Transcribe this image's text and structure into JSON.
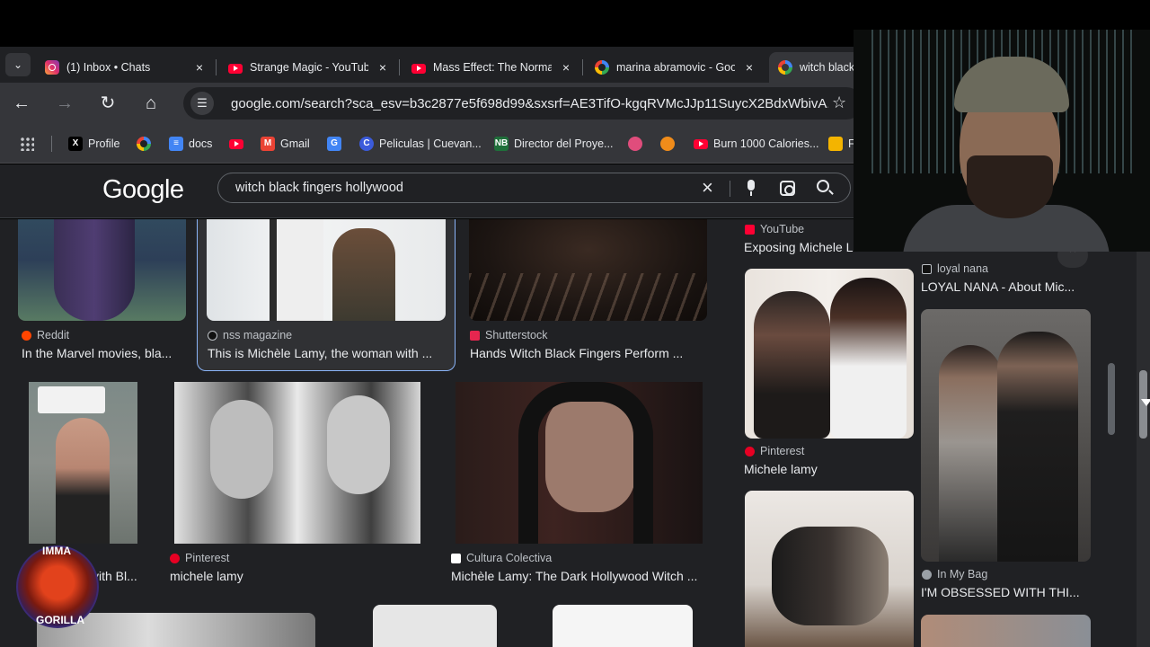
{
  "browser": {
    "tabs": [
      {
        "title": "(1) Inbox • Chats",
        "favicon": "instagram-icon",
        "active": false
      },
      {
        "title": "Strange Magic - YouTube",
        "favicon": "youtube-icon",
        "active": false
      },
      {
        "title": "Mass Effect: The Normandy",
        "favicon": "youtube-icon",
        "active": false
      },
      {
        "title": "marina abramovic - Google",
        "favicon": "google-icon",
        "active": false
      },
      {
        "title": "witch black",
        "favicon": "google-icon",
        "active": true
      }
    ],
    "close_glyph": "×",
    "url": "google.com/search?sca_esv=b3c2877e5f698d99&sxsrf=AE3TifO-kgqRVMcJJp11SuycX2BdxWbivA...",
    "bookmarks": [
      {
        "label": "Profile",
        "icon": "x-icon",
        "color": "#000000"
      },
      {
        "label": "",
        "icon": "google-icon",
        "color": "#ffffff"
      },
      {
        "label": "docs",
        "icon": "docs-icon",
        "color": "#4285f4"
      },
      {
        "label": "",
        "icon": "youtube-icon",
        "color": "#ff0033"
      },
      {
        "label": "Gmail",
        "icon": "gmail-icon",
        "color": "#ea4335"
      },
      {
        "label": "",
        "icon": "translate-icon",
        "color": "#4285f4"
      },
      {
        "label": "Peliculas | Cuevan...",
        "icon": "cuevana-icon",
        "color": "#3b5bdb"
      },
      {
        "label": "Director del Proye...",
        "icon": "nb-icon",
        "color": "#1f6f3a"
      },
      {
        "label": "",
        "icon": "firefox-icon",
        "color": "#e04d7c"
      },
      {
        "label": "",
        "icon": "orange-icon",
        "color": "#f08c1a"
      },
      {
        "label": "Burn 1000 Calories...",
        "icon": "youtube-icon",
        "color": "#ff0033"
      },
      {
        "label": "F",
        "icon": "chart-icon",
        "color": "#f4b400"
      }
    ]
  },
  "search": {
    "logo": "Google",
    "query": "witch black fingers hollywood"
  },
  "results": {
    "left": [
      {
        "source": "Reddit",
        "title": "In the Marvel movies, bla...",
        "src_color": "#ff4500"
      },
      {
        "source": "nss magazine",
        "title": "This is Michèle Lamy, the woman with ...",
        "src_color": "#111111"
      },
      {
        "source": "Shutterstock",
        "title": "Hands Witch Black Fingers Perform ...",
        "src_color": "#e6264f"
      },
      {
        "source": "",
        "title": "vith Bl...",
        "src_color": "#888888"
      },
      {
        "source": "Pinterest",
        "title": "michele lamy",
        "src_color": "#e60023"
      },
      {
        "source": "Cultura Colectiva",
        "title": "Michèle Lamy: The Dark Hollywood Witch ...",
        "src_color": "#ffffff"
      }
    ],
    "right": [
      {
        "source": "YouTube",
        "title": "Exposing Michele L",
        "src_color": "#ff0033"
      },
      {
        "source": "loyal nana",
        "title": "LOYAL NANA - About Mic...",
        "src_color": "#111111"
      },
      {
        "source": "Pinterest",
        "title": "Michele lamy",
        "src_color": "#e60023"
      },
      {
        "source": "In My Bag",
        "title": "I'M OBSESSED WITH THI...",
        "src_color": "#9aa0a6"
      }
    ]
  },
  "overlay": {
    "channel_top": "IMMA",
    "channel_bottom": "GORILLA"
  }
}
